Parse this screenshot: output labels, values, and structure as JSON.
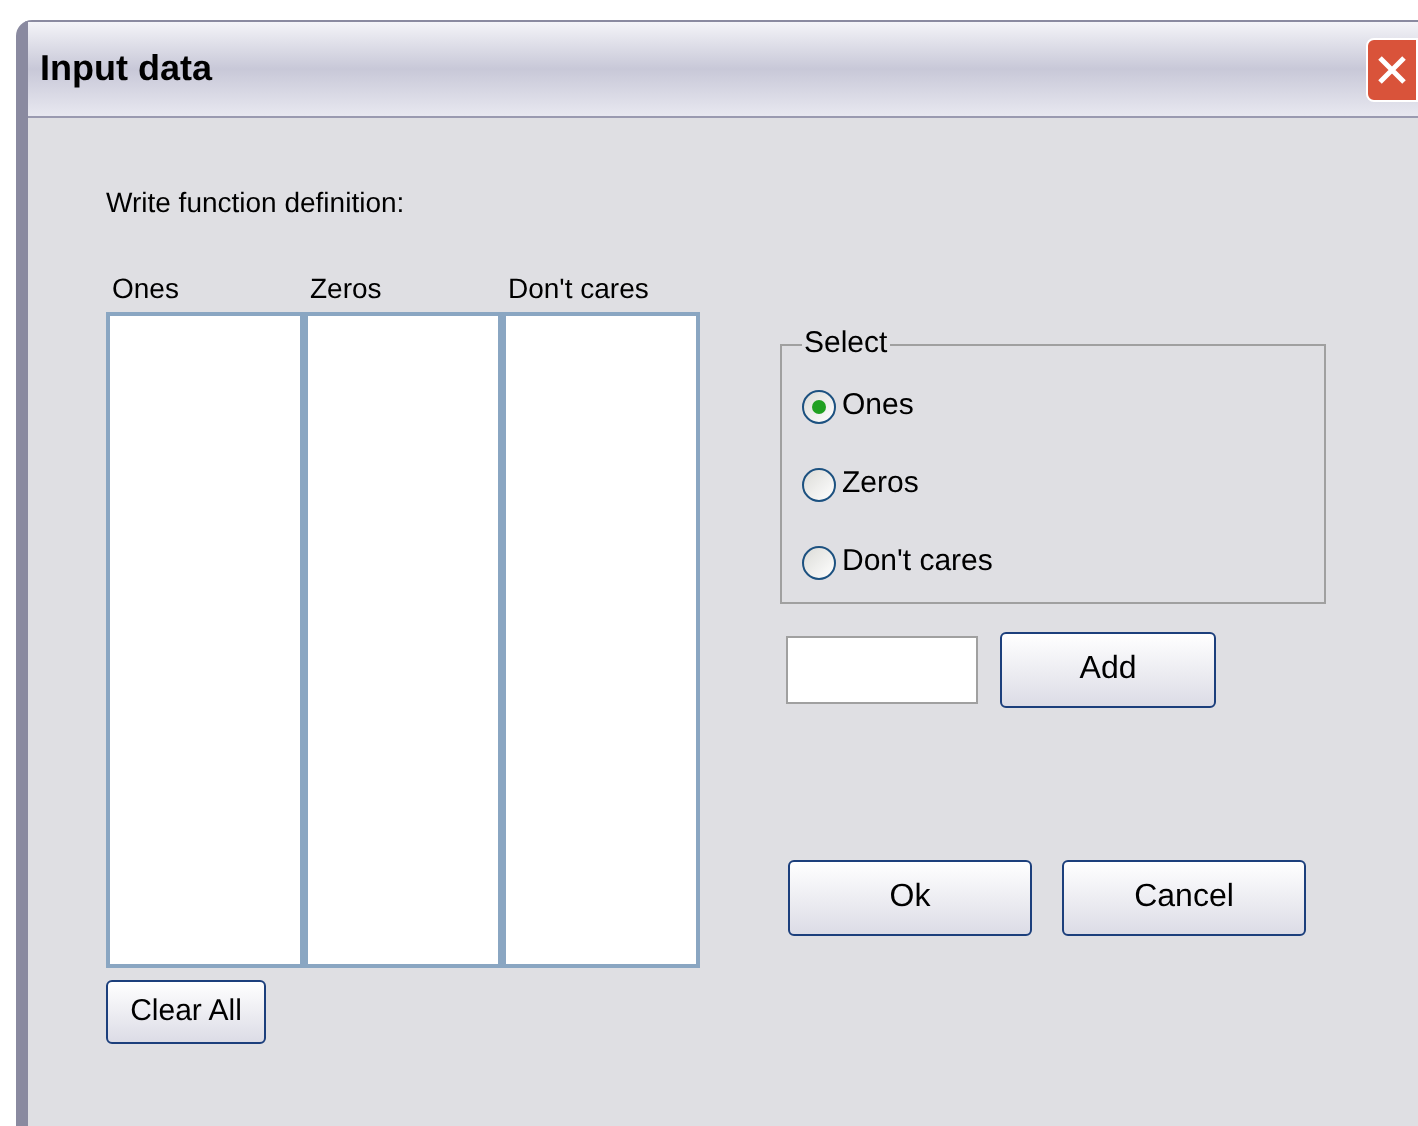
{
  "window": {
    "title": "Input data"
  },
  "prompt": "Write function definition:",
  "lists": [
    {
      "heading": "Ones"
    },
    {
      "heading": "Zeros"
    },
    {
      "heading": "Don't cares"
    }
  ],
  "clear_button": "Clear All",
  "select_group": {
    "label": "Select",
    "options": [
      {
        "label": "Ones",
        "selected": true
      },
      {
        "label": "Zeros",
        "selected": false
      },
      {
        "label": "Don't cares",
        "selected": false
      }
    ]
  },
  "add_button": "Add",
  "buttons": [
    "Ok",
    "Cancel"
  ]
}
